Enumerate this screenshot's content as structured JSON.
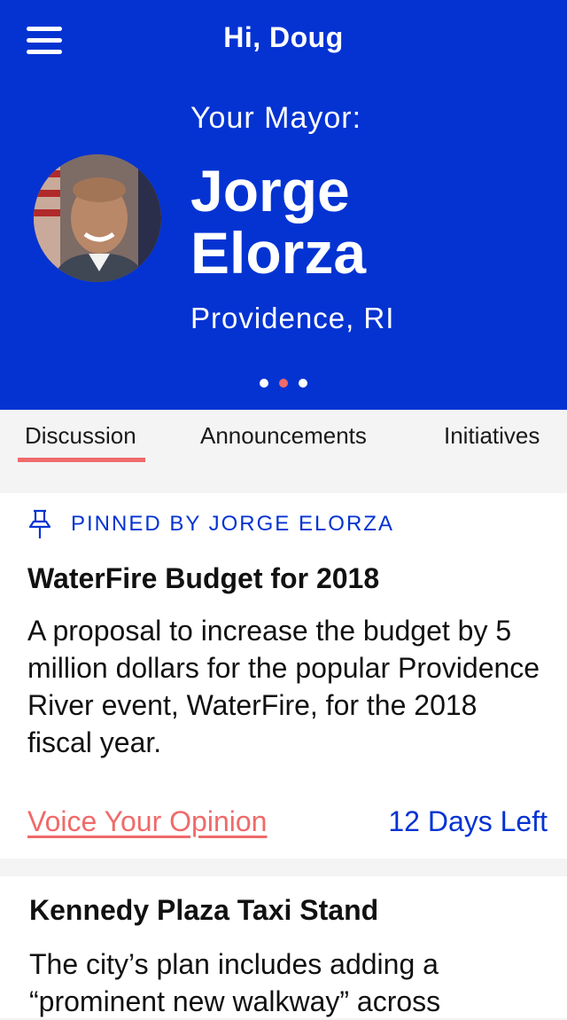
{
  "header": {
    "greeting": "Hi, Doug",
    "mayor_label": "Your Mayor:",
    "mayor_first_name": "Jorge",
    "mayor_last_name": "Elorza",
    "city": "Providence, RI",
    "pager": {
      "count": 3,
      "active_index": 1
    },
    "background_color": "#0433d2",
    "avatar_icon": "mayor-portrait"
  },
  "tabs": [
    {
      "label": "Discussion",
      "active": true
    },
    {
      "label": "Announcements",
      "active": false
    },
    {
      "label": "Initiatives",
      "active": false
    }
  ],
  "posts": [
    {
      "pinned_label": "PINNED BY JORGE ELORZA",
      "pin_icon": "pushpin-icon",
      "title": "WaterFire Budget for 2018",
      "body": "A proposal to increase the budget by 5 million dollars for the popular Providence River event, WaterFire, for the 2018 fiscal year.",
      "action_label": "Voice Your Opinion",
      "deadline": "12 Days Left"
    },
    {
      "title": "Kennedy Plaza Taxi Stand",
      "body": "The city’s plan includes adding a “prominent new walkway” across"
    }
  ],
  "colors": {
    "accent": "#f06a6a",
    "brand": "#0433d2"
  }
}
